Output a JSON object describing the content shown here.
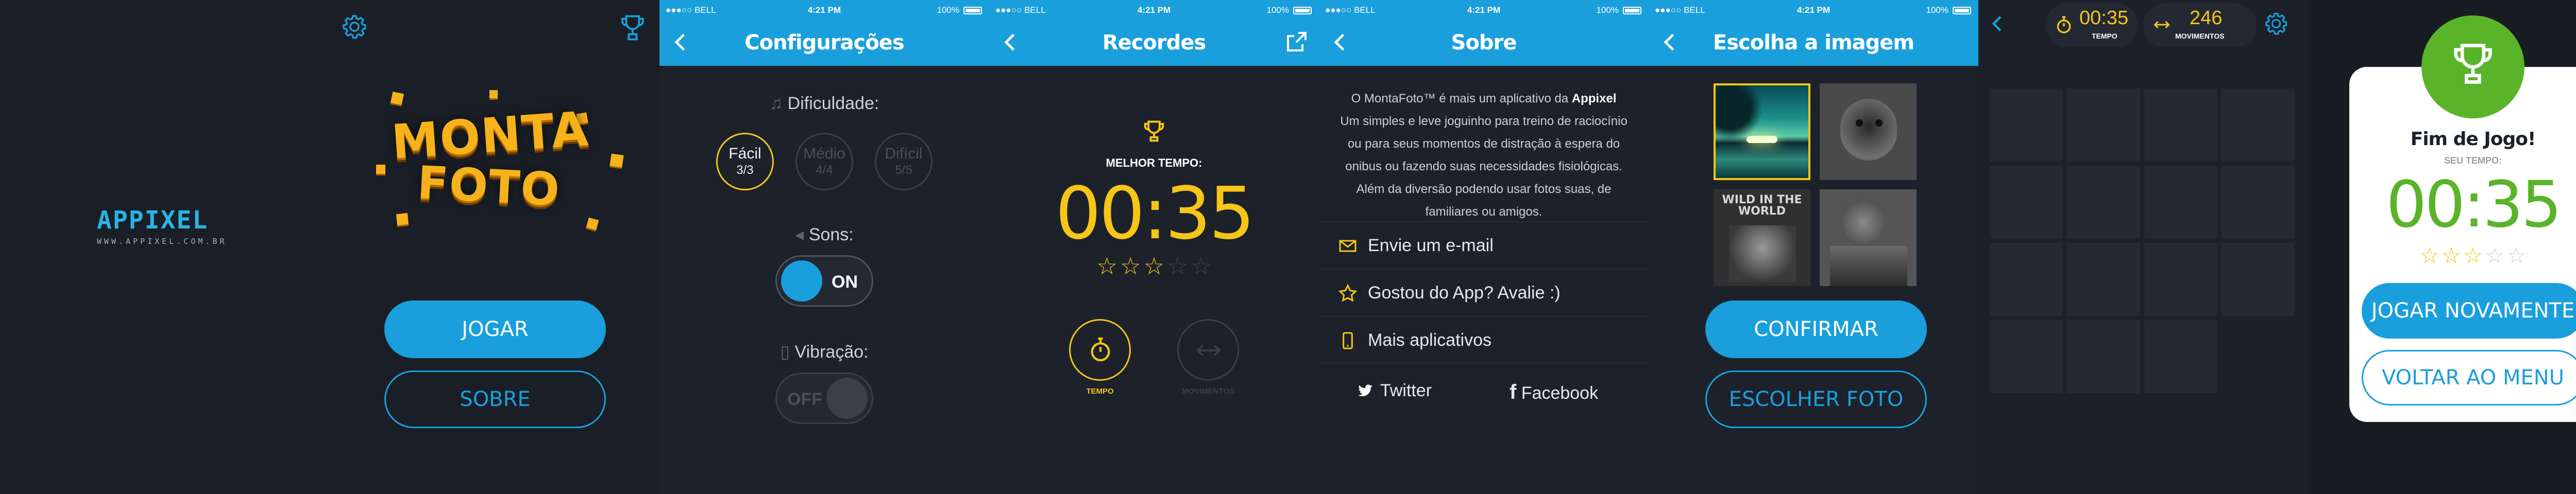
{
  "status_bar": {
    "carrier": "●●●○○ BELL",
    "time": "4:21 PM",
    "battery": "100%"
  },
  "home": {
    "brand_name": "APPIXEL",
    "brand_site": "WWW.APPIXEL.COM.BR",
    "logo_line1": "MONTA",
    "logo_line2": "FOTO",
    "play_label": "JOGAR",
    "about_label": "SOBRE"
  },
  "settings": {
    "title": "Configurações",
    "difficulty_label": "Dificuldade:",
    "difficulties": [
      {
        "name": "Fácil",
        "count": "3/3"
      },
      {
        "name": "Médio",
        "count": "4/4"
      },
      {
        "name": "Difícil",
        "count": "5/5"
      }
    ],
    "sound_label": "Sons:",
    "sound_state": "ON",
    "vibration_label": "Vibração:",
    "vibration_state": "OFF"
  },
  "records": {
    "title": "Recordes",
    "best_time_label": "MELHOR TEMPO:",
    "best_time": "00:35",
    "stars_filled": 2.5,
    "stars_total": 5,
    "tab_time": "TEMPO",
    "tab_moves": "MOVIMENTOS"
  },
  "about": {
    "title": "Sobre",
    "text_pre": "O MontaFoto™ é mais um aplicativo da ",
    "text_brand": "Appixel",
    "text_body": "Um simples e leve joguinho para treino de raciocínio ou para seus momentos de distração à espera do onibus ou fazendo suas necessidades fisiológicas. Além da diversão podendo usar fotos suas, de familiares ou amigos.",
    "items": [
      "Envie um e-mail",
      "Gostou do App? Avalie :)",
      "Mais aplicativos"
    ],
    "twitter": "Twitter",
    "facebook": "Facebook"
  },
  "choose": {
    "title": "Escolha a imagem",
    "confirm_label": "CONFIRMAR",
    "choose_label": "ESCOLHER FOTO",
    "thumb_text": "WILD IN THE WORLD"
  },
  "game": {
    "time_value": "00:35",
    "time_label": "TEMPO",
    "moves_value": "246",
    "moves_label": "MOVIMENTOS"
  },
  "gameover": {
    "title": "Fim de Jogo!",
    "your_time_label": "SEU TEMPO:",
    "time": "00:35",
    "stars_filled": 2.5,
    "stars_total": 5,
    "play_again_label": "JOGAR NOVAMENTE",
    "back_menu_label": "VOLTAR AO MENU"
  },
  "colors": {
    "accent": "#1a9fdc",
    "gold": "#f5c518",
    "success": "#5ab42a",
    "background": "#1c212a"
  }
}
